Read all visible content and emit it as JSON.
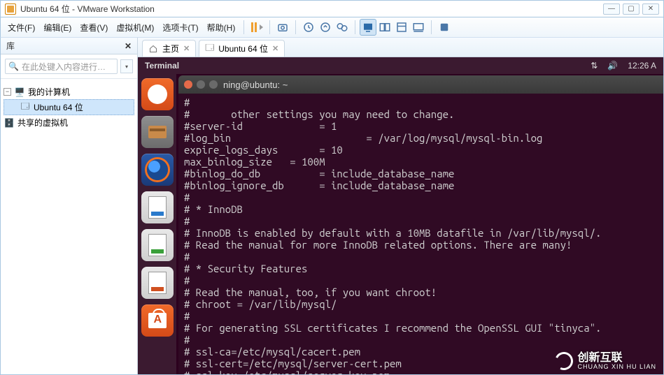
{
  "window": {
    "title": "Ubuntu 64 位 - VMware Workstation"
  },
  "menu": {
    "items": [
      "文件(F)",
      "编辑(E)",
      "查看(V)",
      "虚拟机(M)",
      "选项卡(T)",
      "帮助(H)"
    ]
  },
  "sidebar": {
    "header": "库",
    "search_placeholder": "在此处键入内容进行…",
    "tree": {
      "root": "我的计算机",
      "child_selected": "Ubuntu 64 位",
      "shared": "共享的虚拟机"
    }
  },
  "tabs": {
    "home": "主页",
    "vm": "Ubuntu 64 位"
  },
  "ubuntu_bar": {
    "app": "Terminal",
    "clock": "12:26 A"
  },
  "terminal": {
    "title": "ning@ubuntu: ~",
    "lines": [
      "#",
      "#       other settings you may need to change.",
      "#server-id             = 1",
      "#log_bin                       = /var/log/mysql/mysql-bin.log",
      "expire_logs_days       = 10",
      "max_binlog_size   = 100M",
      "#binlog_do_db          = include_database_name",
      "#binlog_ignore_db      = include_database_name",
      "#",
      "# * InnoDB",
      "#",
      "# InnoDB is enabled by default with a 10MB datafile in /var/lib/mysql/.",
      "# Read the manual for more InnoDB related options. There are many!",
      "#",
      "# * Security Features",
      "#",
      "# Read the manual, too, if you want chroot!",
      "# chroot = /var/lib/mysql/",
      "#",
      "# For generating SSL certificates I recommend the OpenSSL GUI \"tinyca\".",
      "#",
      "# ssl-ca=/etc/mysql/cacert.pem",
      "# ssl-cert=/etc/mysql/server-cert.pem",
      "# ssl-key=/etc/mysql/server-key.pem"
    ]
  },
  "watermark": {
    "brand": "创新互联",
    "sub": "CHUANG XIN HU LIAN"
  }
}
